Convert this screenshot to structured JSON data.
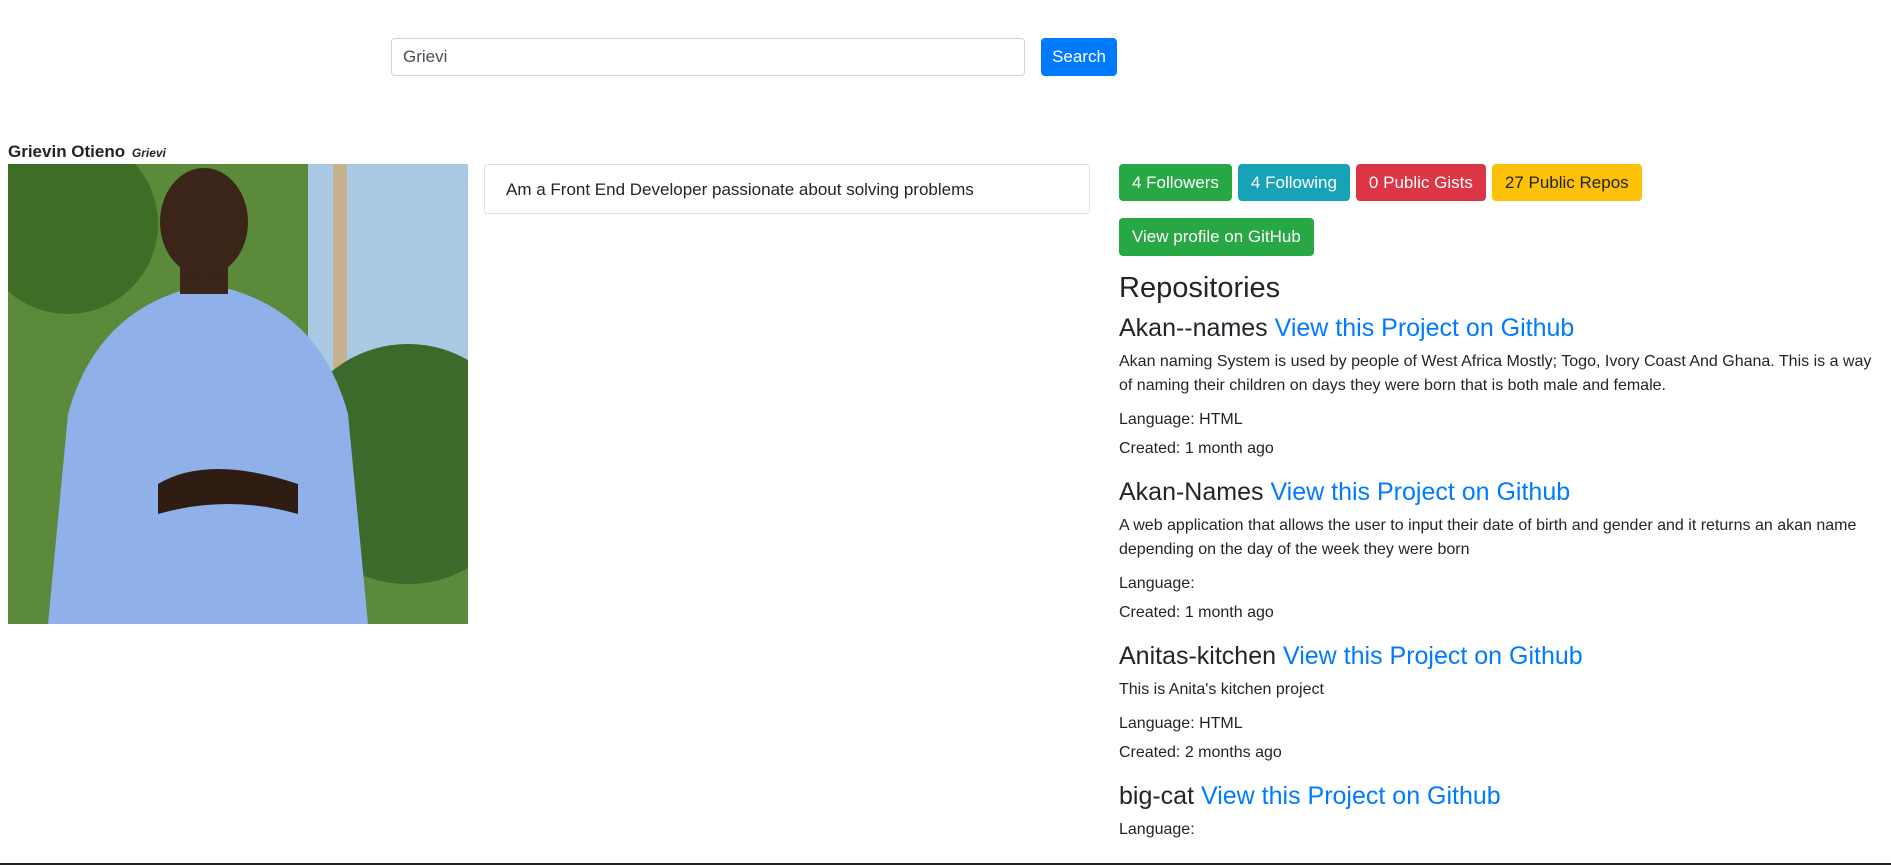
{
  "search": {
    "value": "Grievi",
    "button_label": "Search"
  },
  "user": {
    "name": "Grievin Otieno",
    "login": "Grievi",
    "bio": "Am a Front End Developer passionate about solving problems"
  },
  "stats": {
    "followers": "4 Followers",
    "following": "4 Following",
    "gists": "0 Public Gists",
    "repos": "27 Public Repos"
  },
  "profile_button_label": "View profile on GitHub",
  "repositories": {
    "heading": "Repositories",
    "link_label": "View this Project on Github",
    "items": [
      {
        "name": "Akan--names",
        "description": "Akan naming System is used by people of West Africa Mostly; Togo, Ivory Coast And Ghana. This is a way of naming their children on days they were born that is both male and female.",
        "language": "Language: HTML",
        "created": "Created: 1 month ago"
      },
      {
        "name": "Akan-Names",
        "description": "A web application that allows the user to input their date of birth and gender and it returns an akan name depending on the day of the week they were born",
        "language": "Language:",
        "created": "Created: 1 month ago"
      },
      {
        "name": "Anitas-kitchen",
        "description": "This is Anita's kitchen project",
        "language": "Language: HTML",
        "created": "Created: 2 months ago"
      },
      {
        "name": "big-cat",
        "language": "Language:"
      }
    ]
  },
  "colors": {
    "primary": "#007bff",
    "success": "#28a745",
    "info": "#17a2b8",
    "danger": "#dc3545",
    "warning": "#ffc107"
  }
}
